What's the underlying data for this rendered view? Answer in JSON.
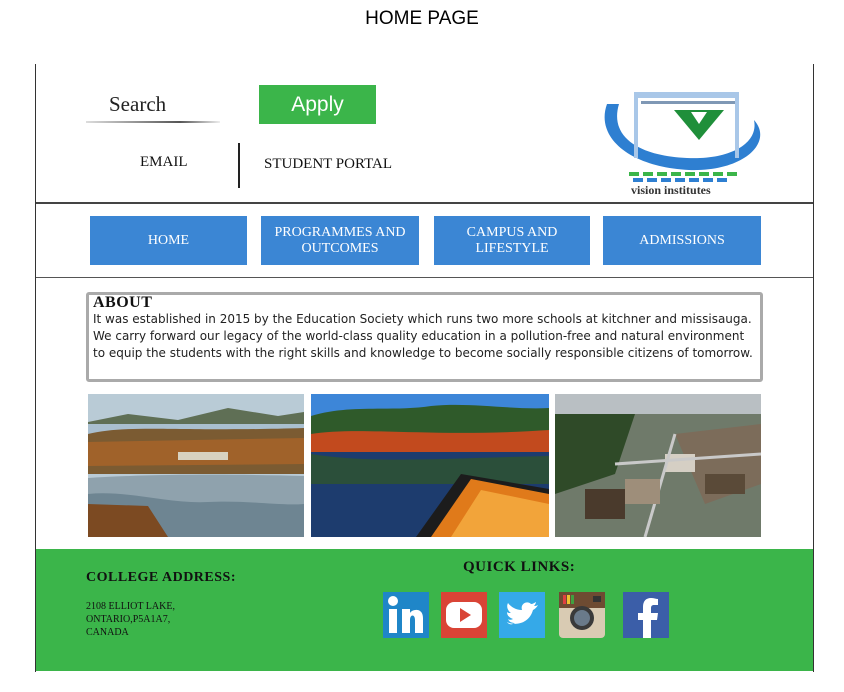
{
  "caption": "HOME PAGE",
  "header": {
    "search_label": "Search",
    "apply_label": "Apply",
    "email_label": "EMAIL",
    "portal_label": "STUDENT PORTAL",
    "logo_text": "vision institutes"
  },
  "nav": [
    {
      "label": "HOME"
    },
    {
      "label": "PROGRAMMES AND OUTCOMES"
    },
    {
      "label": "CAMPUS AND LIFESTYLE"
    },
    {
      "label": "ADMISSIONS"
    }
  ],
  "about": {
    "title": "ABOUT",
    "text": "It was established in 2015 by the Education Society which runs two more schools at kitchner and missisauga. We carry forward our legacy of the world-class quality education in a pollution-free and natural environment to equip the students with the right skills and knowledge to become socially responsible citizens of tomorrow."
  },
  "photos": [
    {
      "name": "lake-autumn-photo"
    },
    {
      "name": "kayak-lake-photo"
    },
    {
      "name": "aerial-town-photo"
    }
  ],
  "footer": {
    "address_title": "COLLEGE ADDRESS:",
    "address_lines": [
      "2108 ELLIOT LAKE,",
      "ONTARIO,P5A1A7,",
      "CANADA"
    ],
    "quick_links_title": "QUICK LINKS:",
    "social": [
      "linkedin-icon",
      "youtube-icon",
      "twitter-icon",
      "instagram-icon",
      "facebook-icon"
    ]
  },
  "colors": {
    "accent_green": "#3bb54a",
    "nav_blue": "#3b86d4"
  }
}
